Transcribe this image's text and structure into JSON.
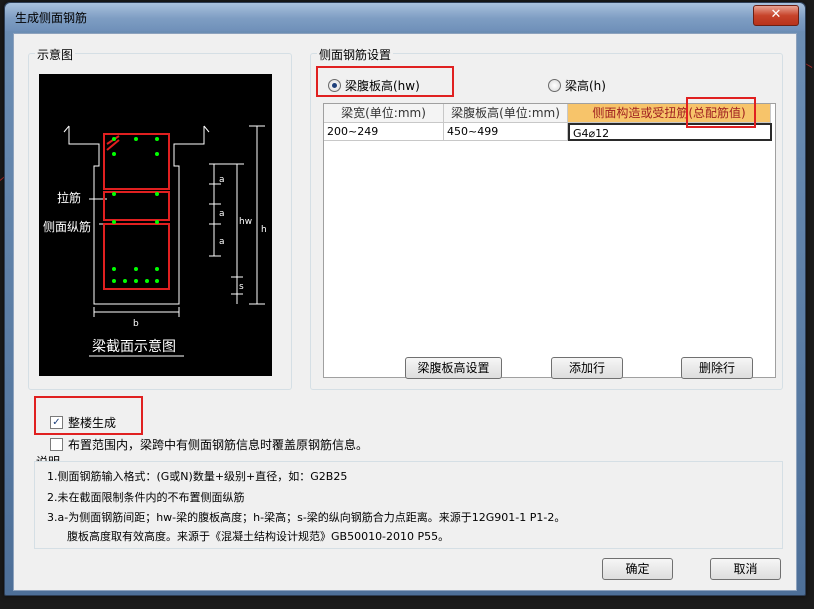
{
  "window": {
    "title": "生成侧面钢筋",
    "close_glyph": "✕"
  },
  "schematic_group": {
    "label": "示意图",
    "labels": {
      "tie_bar": "拉筋",
      "side_long_bar": "侧面纵筋",
      "caption": "梁截面示意图"
    },
    "dims": {
      "a1": "a",
      "a2": "a",
      "a3": "a",
      "hw": "hw",
      "h": "h",
      "s": "s",
      "b": "b"
    }
  },
  "settings_group": {
    "label": "侧面钢筋设置",
    "options": [
      {
        "label": "梁腹板高(hw)",
        "selected": true
      },
      {
        "label": "梁高(h)",
        "selected": false
      }
    ],
    "table": {
      "headers": [
        "梁宽(单位:mm)",
        "梁腹板高(单位:mm)",
        "侧面构造或受扭筋(总配筋值)"
      ],
      "rows": [
        [
          "200~249",
          "450~499",
          "G4⌀12"
        ]
      ]
    },
    "buttons": {
      "web_height": "梁腹板高设置",
      "add_row": "添加行",
      "delete_row": "删除行"
    }
  },
  "whole_building": {
    "label": "整楼生成",
    "checked": true
  },
  "override": {
    "label": "布置范围内，梁跨中有侧面钢筋信息时覆盖原钢筋信息。",
    "checked": false
  },
  "notes": {
    "label": "说明",
    "lines": [
      "1.侧面钢筋输入格式：(G或N)数量+级别+直径，如：G2B25",
      "2.未在截面限制条件内的不布置侧面纵筋",
      "3.a-为侧面钢筋间距；hw-梁的腹板高度；h-梁高；s-梁的纵向钢筋合力点距离。来源于12G901-1 P1-2。",
      "腹板高度取有效高度。来源于《混凝土结构设计规范》GB50010-2010 P55。"
    ]
  },
  "footer": {
    "ok": "确定",
    "cancel": "取消"
  },
  "colors": {
    "highlight_box": "#e02020",
    "drawing_bg": "#000000",
    "drawing_line": "#ffffff",
    "rebar_dot": "#00ff00"
  }
}
